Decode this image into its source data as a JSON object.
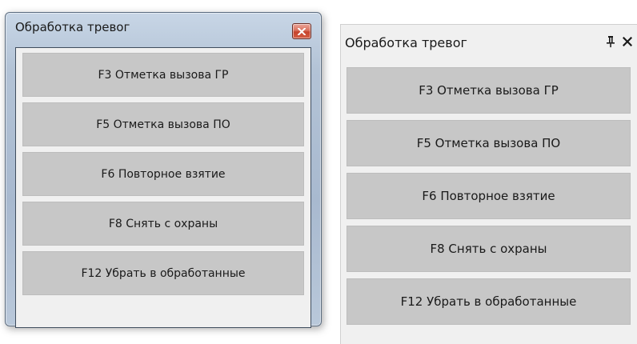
{
  "floating_window": {
    "title": "Обработка тревог",
    "close_icon": "close-icon",
    "actions": [
      {
        "label": "F3  Отметка вызова ГР"
      },
      {
        "label": "F5  Отметка вызова ПО"
      },
      {
        "label": "F6  Повторное взятие"
      },
      {
        "label": "F8  Снять с охраны"
      },
      {
        "label": "F12 Убрать в обработанные"
      }
    ]
  },
  "docked_panel": {
    "title": "Обработка тревог",
    "pin_icon": "pin-icon",
    "close_icon": "close-icon",
    "actions": [
      {
        "label": "F3  Отметка вызова ГР"
      },
      {
        "label": "F5  Отметка вызова ПО"
      },
      {
        "label": "F6  Повторное взятие"
      },
      {
        "label": "F8  Снять с охраны"
      },
      {
        "label": "F12 Убрать в обработанные"
      }
    ]
  },
  "colors": {
    "button_bg": "#c7c7c7",
    "panel_bg": "#f0f0f0",
    "close_button_red": "#c4432c"
  }
}
